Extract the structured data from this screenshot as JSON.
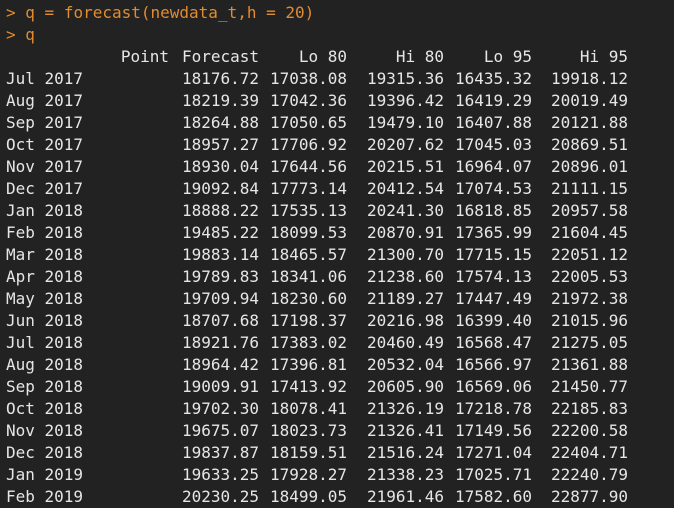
{
  "console": {
    "commands": [
      {
        "prompt": ">",
        "text": "q = forecast(newdata_t,h = 20)"
      },
      {
        "prompt": ">",
        "text": "q"
      }
    ],
    "columns": [
      "Point",
      "Forecast",
      "Lo 80",
      "Hi 80",
      "Lo 95",
      "Hi 95"
    ],
    "rows": [
      {
        "label": "Jul 2017",
        "forecast": "18176.72",
        "lo80": "17038.08",
        "hi80": "19315.36",
        "lo95": "16435.32",
        "hi95": "19918.12"
      },
      {
        "label": "Aug 2017",
        "forecast": "18219.39",
        "lo80": "17042.36",
        "hi80": "19396.42",
        "lo95": "16419.29",
        "hi95": "20019.49"
      },
      {
        "label": "Sep 2017",
        "forecast": "18264.88",
        "lo80": "17050.65",
        "hi80": "19479.10",
        "lo95": "16407.88",
        "hi95": "20121.88"
      },
      {
        "label": "Oct 2017",
        "forecast": "18957.27",
        "lo80": "17706.92",
        "hi80": "20207.62",
        "lo95": "17045.03",
        "hi95": "20869.51"
      },
      {
        "label": "Nov 2017",
        "forecast": "18930.04",
        "lo80": "17644.56",
        "hi80": "20215.51",
        "lo95": "16964.07",
        "hi95": "20896.01"
      },
      {
        "label": "Dec 2017",
        "forecast": "19092.84",
        "lo80": "17773.14",
        "hi80": "20412.54",
        "lo95": "17074.53",
        "hi95": "21111.15"
      },
      {
        "label": "Jan 2018",
        "forecast": "18888.22",
        "lo80": "17535.13",
        "hi80": "20241.30",
        "lo95": "16818.85",
        "hi95": "20957.58"
      },
      {
        "label": "Feb 2018",
        "forecast": "19485.22",
        "lo80": "18099.53",
        "hi80": "20870.91",
        "lo95": "17365.99",
        "hi95": "21604.45"
      },
      {
        "label": "Mar 2018",
        "forecast": "19883.14",
        "lo80": "18465.57",
        "hi80": "21300.70",
        "lo95": "17715.15",
        "hi95": "22051.12"
      },
      {
        "label": "Apr 2018",
        "forecast": "19789.83",
        "lo80": "18341.06",
        "hi80": "21238.60",
        "lo95": "17574.13",
        "hi95": "22005.53"
      },
      {
        "label": "May 2018",
        "forecast": "19709.94",
        "lo80": "18230.60",
        "hi80": "21189.27",
        "lo95": "17447.49",
        "hi95": "21972.38"
      },
      {
        "label": "Jun 2018",
        "forecast": "18707.68",
        "lo80": "17198.37",
        "hi80": "20216.98",
        "lo95": "16399.40",
        "hi95": "21015.96"
      },
      {
        "label": "Jul 2018",
        "forecast": "18921.76",
        "lo80": "17383.02",
        "hi80": "20460.49",
        "lo95": "16568.47",
        "hi95": "21275.05"
      },
      {
        "label": "Aug 2018",
        "forecast": "18964.42",
        "lo80": "17396.81",
        "hi80": "20532.04",
        "lo95": "16566.97",
        "hi95": "21361.88"
      },
      {
        "label": "Sep 2018",
        "forecast": "19009.91",
        "lo80": "17413.92",
        "hi80": "20605.90",
        "lo95": "16569.06",
        "hi95": "21450.77"
      },
      {
        "label": "Oct 2018",
        "forecast": "19702.30",
        "lo80": "18078.41",
        "hi80": "21326.19",
        "lo95": "17218.78",
        "hi95": "22185.83"
      },
      {
        "label": "Nov 2018",
        "forecast": "19675.07",
        "lo80": "18023.73",
        "hi80": "21326.41",
        "lo95": "17149.56",
        "hi95": "22200.58"
      },
      {
        "label": "Dec 2018",
        "forecast": "19837.87",
        "lo80": "18159.51",
        "hi80": "21516.24",
        "lo95": "17271.04",
        "hi95": "22404.71"
      },
      {
        "label": "Jan 2019",
        "forecast": "19633.25",
        "lo80": "17928.27",
        "hi80": "21338.23",
        "lo95": "17025.71",
        "hi95": "22240.79"
      },
      {
        "label": "Feb 2019",
        "forecast": "20230.25",
        "lo80": "18499.05",
        "hi80": "21961.46",
        "lo95": "17582.60",
        "hi95": "22877.90"
      }
    ]
  },
  "colors": {
    "background": "#222222",
    "prompt": "#e38b2e",
    "output_text": "#e6e6e6"
  }
}
